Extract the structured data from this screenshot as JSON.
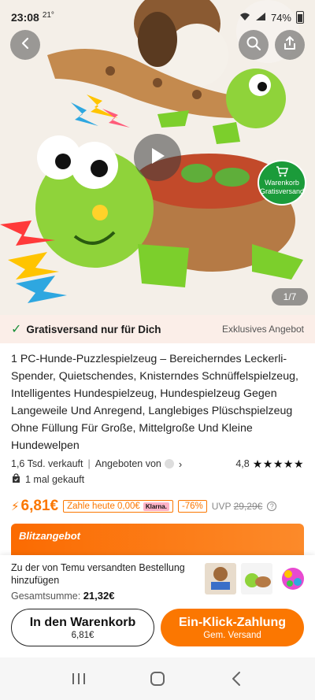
{
  "status_bar": {
    "time": "23:08",
    "temperature": "21°",
    "battery": "74%"
  },
  "hero": {
    "page_indicator": "1/7",
    "cart_badge": {
      "label_top": "Warenkorb",
      "label_bottom": "Gratisversand"
    },
    "icons": {
      "back": "back-arrow-icon",
      "search": "search-icon",
      "share": "share-icon",
      "play": "play-icon"
    }
  },
  "shipping_banner": {
    "text": "Gratisversand nur für Dich",
    "exclusive": "Exklusives Angebot"
  },
  "product": {
    "title": "1 PC-Hunde-Puzzlespielzeug – Bereicherndes Leckerli-Spender, Quietschendes, Knisterndes Schnüffelspielzeug, Intelligentes Hundespielzeug, Hundespielzeug Gegen Langeweile Und Anregend, Langlebiges Plüschspielzeug Ohne Füllung Für Große, Mittelgroße Und Kleine Hundewelpen",
    "sold": "1,6 Tsd. verkauft",
    "offered_by": "Angeboten von",
    "rating": "4,8",
    "stars": "★★★★★",
    "bought_once": "1 mal gekauft"
  },
  "price": {
    "current": "6,81€",
    "pay_today": "Zahle heute 0,00€",
    "klarna": "Klarna.",
    "discount": "-76%",
    "uvp_label": "UVP",
    "uvp_old": "29,29€"
  },
  "flash_sale": {
    "label": "Blitzangebot"
  },
  "cart_panel": {
    "message": "Zu der von Temu versandten Bestellung hinzufügen",
    "total_label": "Gesamtsumme:",
    "total_value": "21,32€",
    "add_to_cart": {
      "label": "In den Warenkorb",
      "price": "6,81€"
    },
    "one_click": {
      "label": "Ein-Klick-Zahlung",
      "sub": "Gem. Versand"
    }
  },
  "navbar": {
    "icons": [
      "recent-apps-icon",
      "home-icon",
      "back-icon"
    ]
  },
  "colors": {
    "accent": "#fb7701",
    "green": "#1b9b3a",
    "banner_bg": "#fbeee8"
  }
}
